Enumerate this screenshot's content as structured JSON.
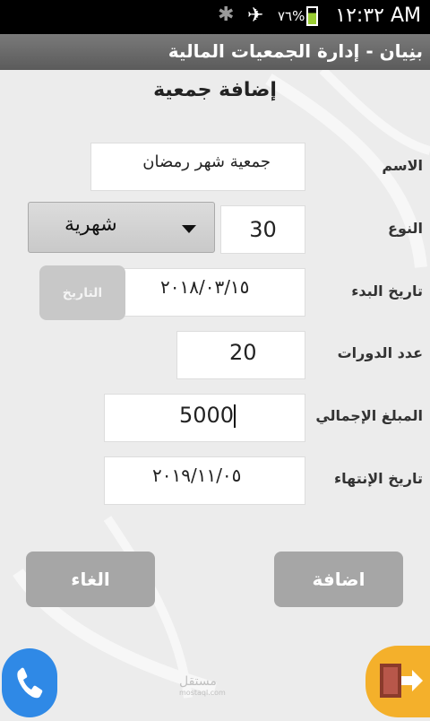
{
  "status_bar": {
    "time": "١٢:٣٢ AM",
    "battery_percent": "٧٦%",
    "battery_level": 0.76,
    "icons": [
      "bluetooth-icon",
      "airplane-mode-icon",
      "battery-icon"
    ]
  },
  "app_title": "بنِيان - إدارة الجمعيات المالية",
  "page_heading": "إضافة جمعية",
  "form": {
    "name": {
      "label": "الاسم",
      "value": "جمعية شهر رمضان"
    },
    "type": {
      "label": "النوع",
      "count": "30",
      "selected": "شهرية"
    },
    "start_date": {
      "label": "تاريخ البدء",
      "value": "٢٠١٨/٠٣/١٥",
      "button": "التاريخ"
    },
    "cycles": {
      "label": "عدد الدورات",
      "value": "20"
    },
    "total": {
      "label": "المبلغ الإجمالي",
      "value": "5000"
    },
    "end_date": {
      "label": "تاريخ الإنتهاء",
      "value": "٢٠١٩/١١/٠٥"
    }
  },
  "buttons": {
    "add": "اضافة",
    "cancel": "الغاء"
  },
  "fabs": {
    "call_icon": "phone-icon",
    "exit_icon": "exit-door-icon"
  },
  "watermark": {
    "line1": "مستقل",
    "line2": "mostaql.com"
  },
  "colors": {
    "titlebar": "#6a6a6a",
    "call_button": "#2f89e6",
    "exit_button": "#f4b02b",
    "action_button": "#a6a6a6"
  }
}
